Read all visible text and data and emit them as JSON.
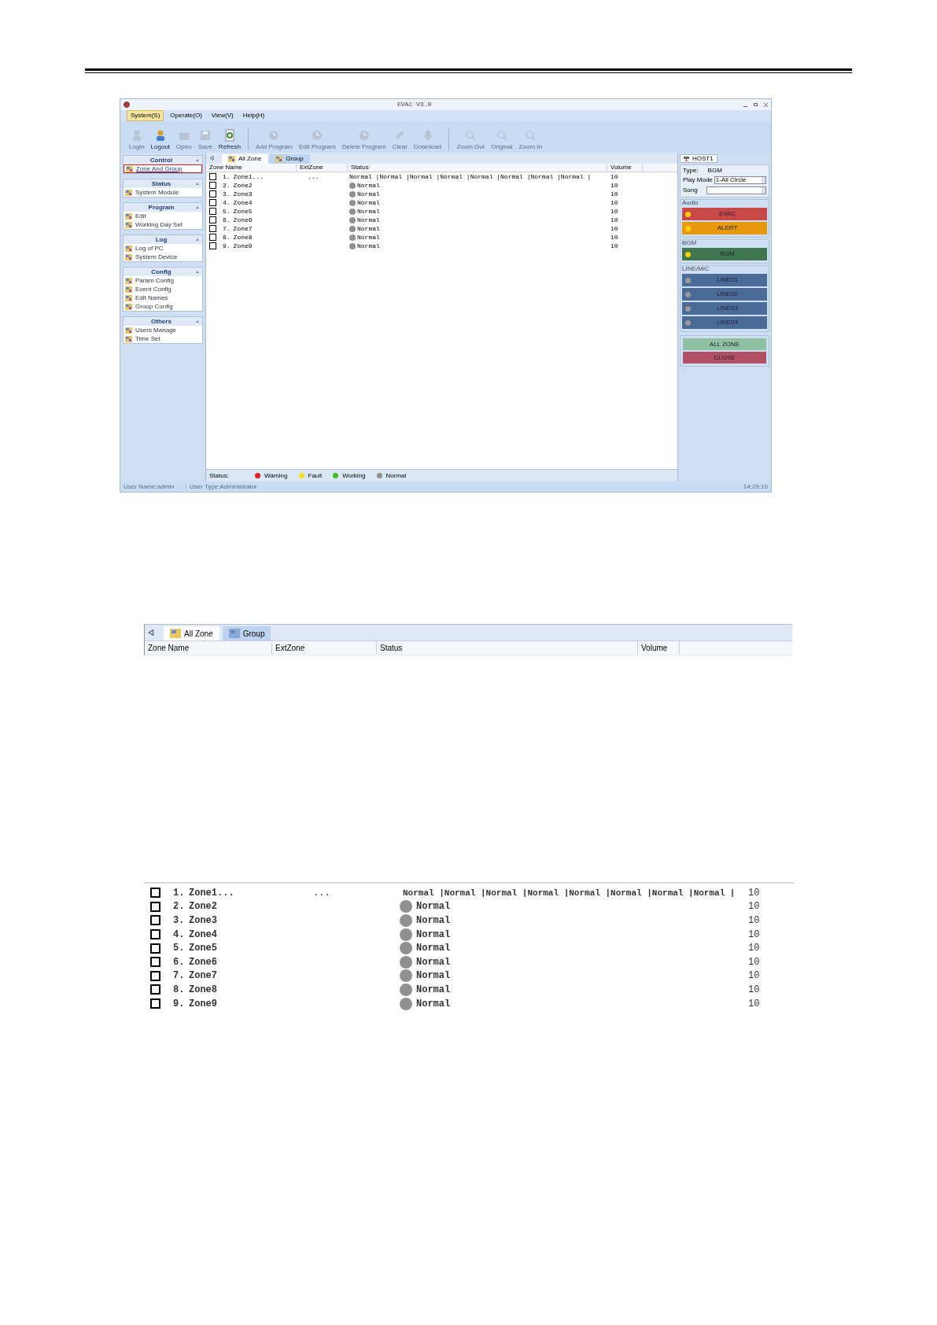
{
  "window": {
    "title": "EVAC V3.0"
  },
  "menu": [
    {
      "label": "System(S)",
      "selected": true
    },
    {
      "label": "Operate(O)",
      "selected": false
    },
    {
      "label": "View(V)",
      "selected": false
    },
    {
      "label": "Help(H)",
      "selected": false
    }
  ],
  "toolbar": [
    {
      "label": "Login",
      "disabled": true,
      "kind": "user"
    },
    {
      "label": "Logout",
      "disabled": false,
      "kind": "user"
    },
    {
      "label": "Open",
      "disabled": true,
      "kind": "folder"
    },
    {
      "label": "Save",
      "disabled": true,
      "kind": "disk"
    },
    {
      "label": "Refresh",
      "disabled": false,
      "kind": "refresh"
    },
    {
      "label": "Add Program",
      "disabled": true,
      "kind": "clock"
    },
    {
      "label": "Edit Program",
      "disabled": true,
      "kind": "clock"
    },
    {
      "label": "Delete Program",
      "disabled": true,
      "kind": "clock"
    },
    {
      "label": "Clear",
      "disabled": true,
      "kind": "broom"
    },
    {
      "label": "Download",
      "disabled": true,
      "kind": "download"
    },
    {
      "label": "Zoom Out",
      "disabled": true,
      "kind": "zoom"
    },
    {
      "label": "Original",
      "disabled": true,
      "kind": "zoom"
    },
    {
      "label": "Zoom In",
      "disabled": true,
      "kind": "zoom"
    }
  ],
  "sidebar": [
    {
      "title": "Control",
      "items": [
        {
          "label": "Zone And Group",
          "selected": true
        }
      ]
    },
    {
      "title": "Status",
      "items": [
        {
          "label": "System Module",
          "selected": false
        }
      ]
    },
    {
      "title": "Program",
      "items": [
        {
          "label": "Edit",
          "selected": false
        },
        {
          "label": "Working Day Set",
          "selected": false
        }
      ]
    },
    {
      "title": "Log",
      "items": [
        {
          "label": "Log of PC",
          "selected": false
        },
        {
          "label": "System Device",
          "selected": false
        }
      ]
    },
    {
      "title": "Config",
      "items": [
        {
          "label": "Param Config",
          "selected": false
        },
        {
          "label": "Event Config",
          "selected": false
        },
        {
          "label": "Edit Names",
          "selected": false
        },
        {
          "label": "Group Config",
          "selected": false
        }
      ]
    },
    {
      "title": "Others",
      "items": [
        {
          "label": "Users Manage",
          "selected": false
        },
        {
          "label": "Time Set",
          "selected": false
        }
      ]
    }
  ],
  "tabs": [
    {
      "label": "All Zone",
      "selected": true
    },
    {
      "label": "Group",
      "selected": false
    }
  ],
  "table": {
    "columns": [
      "Zone Name",
      "ExtZone",
      "Status",
      "Volume"
    ],
    "rows": [
      {
        "checked": false,
        "number": "1.",
        "name": "Zone1...",
        "ext_zone": "...",
        "status": "Normal |Normal |Normal |Normal |Normal |Normal |Normal |Normal |",
        "kind": "plain",
        "volume": "10"
      },
      {
        "checked": false,
        "number": "2.",
        "name": "Zone2",
        "status": "Normal",
        "kind": "lamp",
        "volume": "10"
      },
      {
        "checked": false,
        "number": "3.",
        "name": "Zone3",
        "status": "Normal",
        "kind": "lamp",
        "volume": "10"
      },
      {
        "checked": false,
        "number": "4.",
        "name": "Zone4",
        "status": "Normal",
        "kind": "lamp",
        "volume": "10"
      },
      {
        "checked": false,
        "number": "5.",
        "name": "Zone5",
        "status": "Normal",
        "kind": "lamp",
        "volume": "10"
      },
      {
        "checked": false,
        "number": "6.",
        "name": "Zone6",
        "status": "Normal",
        "kind": "lamp",
        "volume": "10"
      },
      {
        "checked": false,
        "number": "7.",
        "name": "Zone7",
        "status": "Normal",
        "kind": "lamp",
        "volume": "10"
      },
      {
        "checked": false,
        "number": "8.",
        "name": "Zone8",
        "status": "Normal",
        "kind": "lamp",
        "volume": "10"
      },
      {
        "checked": false,
        "number": "9.",
        "name": "Zone9",
        "status": "Normal",
        "kind": "lamp",
        "volume": "10"
      }
    ]
  },
  "legend": {
    "label": "Status:",
    "items": [
      {
        "label": "Warning",
        "color": "#e02020"
      },
      {
        "label": "Fault",
        "color": "#f0e020"
      },
      {
        "label": "Working",
        "color": "#40c020"
      },
      {
        "label": "Normal",
        "color": "#909090"
      }
    ]
  },
  "host": {
    "tab": "HOST1",
    "type_label": "Type:",
    "type_value": "BGM",
    "play_mode_label": "Play Mode",
    "play_mode_value": "1-All Circle",
    "song_label": "Song",
    "groups": [
      {
        "title": "Audio",
        "buttons": [
          {
            "label": "EVAC",
            "color": "#c84848",
            "lamp_on": true
          },
          {
            "label": "ALERT",
            "color": "#e8980c",
            "lamp_on": true
          }
        ]
      },
      {
        "title": "BGM",
        "buttons": [
          {
            "label": "BGM",
            "color": "#3f7650",
            "lamp_on": true
          }
        ]
      },
      {
        "title": "LINE/MIC",
        "buttons": [
          {
            "label": "LINE01",
            "color": "#4a6a98",
            "lamp_on": false
          },
          {
            "label": "LINE02",
            "color": "#4a6a98",
            "lamp_on": false
          },
          {
            "label": "LINE03",
            "color": "#4a6a98",
            "lamp_on": false
          },
          {
            "label": "LINE04",
            "color": "#4a6a98",
            "lamp_on": false
          }
        ]
      }
    ],
    "actions": [
      {
        "label": "ALL ZONE",
        "color": "#8fc0a0"
      },
      {
        "label": "CLOSE",
        "color": "#b05060"
      }
    ]
  },
  "status_bar": [
    "User Name:admin",
    "User Type:Administrator",
    "14:29:10"
  ],
  "detail_tabs": {
    "tabs": [
      {
        "label": "All Zone",
        "selected": true
      },
      {
        "label": "Group",
        "selected": false
      }
    ],
    "columns": [
      "Zone Name",
      "ExtZone",
      "Status",
      "Volume"
    ]
  },
  "detail_rows": [
    {
      "checked": false,
      "number": "1.",
      "name": "Zone1...",
      "ext_zone": "...",
      "status": "Normal |Normal |Normal |Normal |Normal |Normal |Normal |Normal |",
      "kind": "plain",
      "volume": "10"
    },
    {
      "checked": false,
      "number": "2.",
      "name": "Zone2",
      "status": "Normal",
      "kind": "lamp",
      "volume": "10"
    },
    {
      "checked": false,
      "number": "3.",
      "name": "Zone3",
      "status": "Normal",
      "kind": "lamp",
      "volume": "10"
    },
    {
      "checked": false,
      "number": "4.",
      "name": "Zone4",
      "status": "Normal",
      "kind": "lamp",
      "volume": "10"
    },
    {
      "checked": false,
      "number": "5.",
      "name": "Zone5",
      "status": "Normal",
      "kind": "lamp",
      "volume": "10"
    },
    {
      "checked": false,
      "number": "6.",
      "name": "Zone6",
      "status": "Normal",
      "kind": "lamp",
      "volume": "10"
    },
    {
      "checked": false,
      "number": "7.",
      "name": "Zone7",
      "status": "Normal",
      "kind": "lamp",
      "volume": "10"
    },
    {
      "checked": false,
      "number": "8.",
      "name": "Zone8",
      "status": "Normal",
      "kind": "lamp",
      "volume": "10"
    },
    {
      "checked": false,
      "number": "9.",
      "name": "Zone9",
      "status": "Normal",
      "kind": "lamp",
      "volume": "10"
    }
  ]
}
